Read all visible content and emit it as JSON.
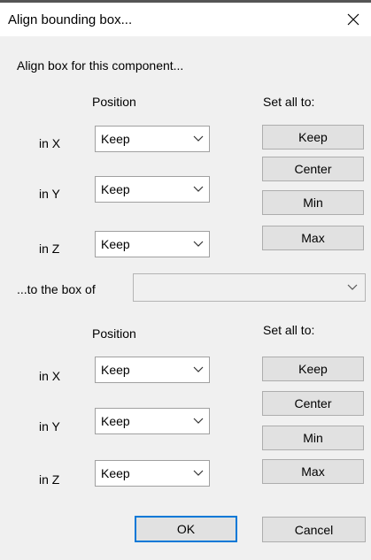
{
  "dialog": {
    "title": "Align bounding box...",
    "close_icon": "close-icon"
  },
  "section1": {
    "heading": "Align box for this component...",
    "position_label": "Position",
    "set_all_label": "Set all to:",
    "rows": [
      {
        "label": "in X",
        "value": "Keep"
      },
      {
        "label": "in Y",
        "value": "Keep"
      },
      {
        "label": "in Z",
        "value": "Keep"
      }
    ],
    "buttons": [
      "Keep",
      "Center",
      "Min",
      "Max"
    ]
  },
  "target": {
    "label": "...to the box of",
    "value": ""
  },
  "section2": {
    "position_label": "Position",
    "set_all_label": "Set all to:",
    "rows": [
      {
        "label": "in X",
        "value": "Keep"
      },
      {
        "label": "in Y",
        "value": "Keep"
      },
      {
        "label": "in Z",
        "value": "Keep"
      }
    ],
    "buttons": [
      "Keep",
      "Center",
      "Min",
      "Max"
    ]
  },
  "footer": {
    "ok_label": "OK",
    "cancel_label": "Cancel"
  },
  "colors": {
    "default_button_border": "#0078d7"
  }
}
